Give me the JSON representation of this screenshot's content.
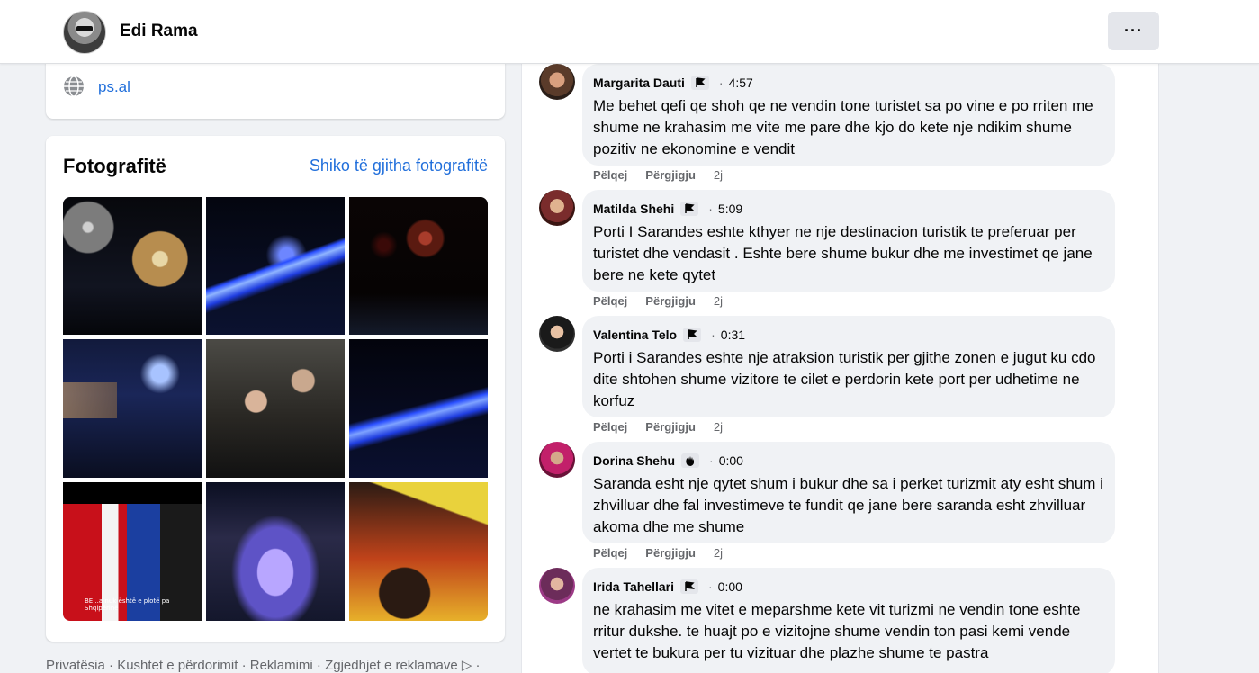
{
  "header": {
    "profile_name": "Edi Rama",
    "more_label": "···"
  },
  "website": {
    "url": "ps.al",
    "icon": "globe-icon"
  },
  "photos": {
    "title": "Fotografitë",
    "see_all": "Shiko të gjitha fotografitë",
    "caption_7": "BE...a nuk është e plotë pa Shqipërinë"
  },
  "footer": {
    "text": "Privatësia · Kushtet e përdorimit · Reklamimi · Zgjedhjet e reklamave ▷ ·"
  },
  "comments": [
    {
      "name": "Margarita Dauti",
      "badge_icon": "flag-icon",
      "time": "4:57",
      "text": "Me behet qefi qe shoh qe ne vendin tone turistet sa po vine e po rriten me shume ne krahasim me vite me pare dhe kjo do kete nje ndikim shume pozitiv ne ekonomine e vendit",
      "like": "Pëlqej",
      "reply": "Përgjigju",
      "age": "2j"
    },
    {
      "name": "Matilda Shehi",
      "badge_icon": "flag-icon",
      "time": "5:09",
      "text": "Porti I Sarandes eshte kthyer ne nje destinacion turistik te preferuar per turistet dhe vendasit . Eshte bere shume bukur dhe me investimet qe jane bere ne kete qytet",
      "like": "Pëlqej",
      "reply": "Përgjigju",
      "age": "2j"
    },
    {
      "name": "Valentina Telo",
      "badge_icon": "flag-icon",
      "time": "0:31",
      "text": "Porti i Sarandes eshte nje atraksion turistik per gjithe zonen e jugut ku cdo dite shtohen shume vizitore te cilet e perdorin kete port per udhetime ne korfuz",
      "like": "Pëlqej",
      "reply": "Përgjigju",
      "age": "2j"
    },
    {
      "name": "Dorina Shehu",
      "badge_icon": "hand-wave-icon",
      "time": "0:00",
      "text": "Saranda esht nje qytet shum i bukur dhe sa i perket turizmit aty esht shum i zhvilluar dhe fal investimeve te fundit qe jane bere saranda esht zhvilluar akoma dhe me shume",
      "like": "Pëlqej",
      "reply": "Përgjigju",
      "age": "2j"
    },
    {
      "name": "Irida Tahellari",
      "badge_icon": "flag-icon",
      "time": "0:00",
      "text": "ne krahasim me vitet e meparshme kete vit turizmi ne vendin tone eshte rritur dukshe. te huajt po e vizitojne shume vendin ton pasi kemi vende vertet te bukura per tu vizituar dhe plazhe shume te pastra",
      "like": "",
      "reply": "",
      "age": ""
    }
  ]
}
